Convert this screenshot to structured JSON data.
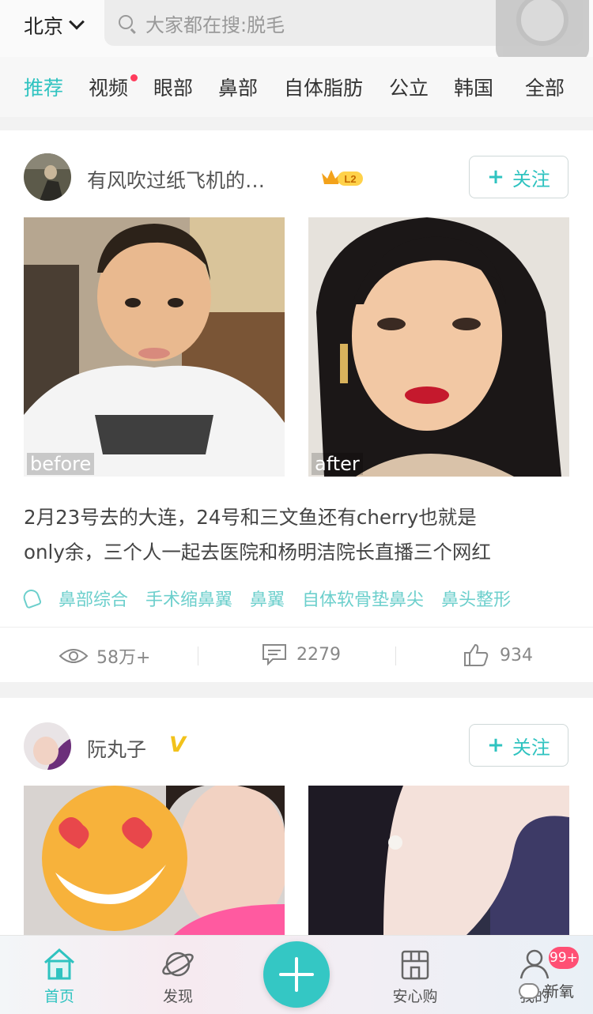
{
  "header": {
    "city": "北京",
    "search_placeholder": "大家都在搜:脱毛"
  },
  "tabs": [
    {
      "label": "推荐",
      "active": true
    },
    {
      "label": "视频",
      "has_dot": true
    },
    {
      "label": "眼部"
    },
    {
      "label": "鼻部"
    },
    {
      "label": "自体脂肪"
    },
    {
      "label": "公立"
    },
    {
      "label": "韩国"
    },
    {
      "label": "全部"
    }
  ],
  "posts": [
    {
      "username": "有风吹过纸飞机的…",
      "level_badge": "L2",
      "follow_label": "关注",
      "before_label": "before",
      "after_label": "after",
      "description_line1": "2月23号去的大连，24号和三文鱼还有cherry也就是",
      "description_line2": "only余，三个人一起去医院和杨明洁院长直播三个网红",
      "tags": [
        "鼻部综合",
        "手术缩鼻翼",
        "鼻翼",
        "自体软骨垫鼻尖",
        "鼻头整形"
      ],
      "views": "58万+",
      "comments": "2279",
      "likes": "934"
    },
    {
      "username": "阮丸子",
      "verified_badge": "V",
      "follow_label": "关注"
    }
  ],
  "bottom_nav": [
    {
      "label": "首页",
      "icon": "home-icon",
      "active": true
    },
    {
      "label": "发现",
      "icon": "planet-icon"
    },
    {
      "label": "安心购",
      "icon": "shop-icon"
    },
    {
      "label": "我的",
      "icon": "user-icon"
    }
  ],
  "notification_badge": "99+",
  "watermark": "新氧",
  "colors": {
    "accent": "#2fc3c0",
    "badge": "#ff4f74",
    "tab_dot": "#ff3b5c"
  }
}
